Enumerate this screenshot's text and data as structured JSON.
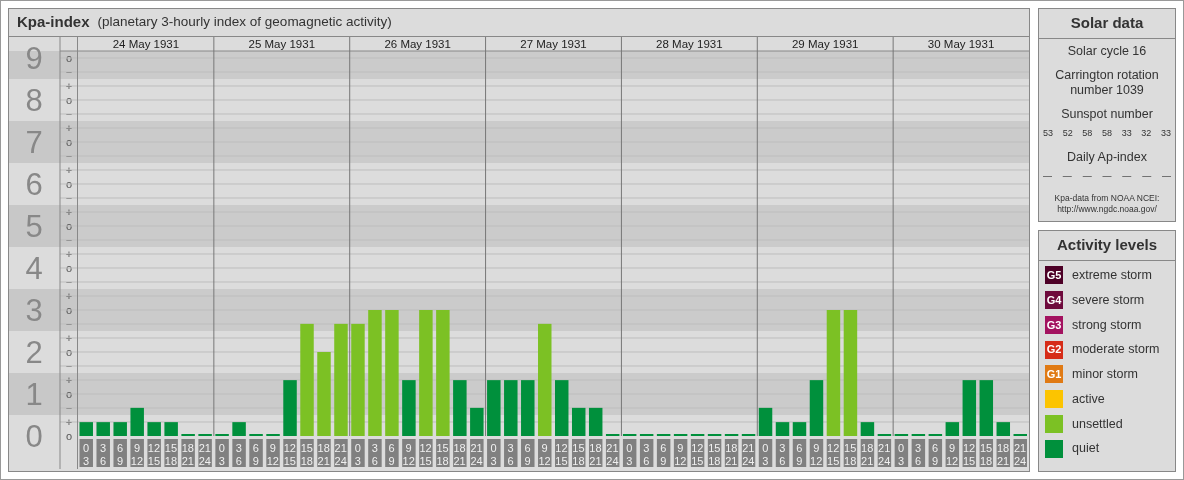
{
  "title": "Kpa-index",
  "subtitle": "(planetary 3-hourly index of geomagnetic activity)",
  "kp_scale": [
    {
      "label": "9",
      "marks": [
        "o",
        "−"
      ]
    },
    {
      "label": "8",
      "marks": [
        "+",
        "o",
        "−"
      ]
    },
    {
      "label": "7",
      "marks": [
        "+",
        "o",
        "−"
      ]
    },
    {
      "label": "6",
      "marks": [
        "+",
        "o",
        "−"
      ]
    },
    {
      "label": "5",
      "marks": [
        "+",
        "o",
        "−"
      ]
    },
    {
      "label": "4",
      "marks": [
        "+",
        "o",
        "−"
      ]
    },
    {
      "label": "3",
      "marks": [
        "+",
        "o",
        "−"
      ]
    },
    {
      "label": "2",
      "marks": [
        "+",
        "o",
        "−"
      ]
    },
    {
      "label": "1",
      "marks": [
        "+",
        "o",
        "−"
      ]
    },
    {
      "label": "0",
      "marks": [
        "+",
        "o"
      ]
    }
  ],
  "days": [
    {
      "date": "24 May 1931",
      "slots": [
        {
          "start": "0",
          "end": "3"
        },
        {
          "start": "3",
          "end": "6"
        },
        {
          "start": "6",
          "end": "9"
        },
        {
          "start": "9",
          "end": "12"
        },
        {
          "start": "12",
          "end": "15"
        },
        {
          "start": "15",
          "end": "18"
        },
        {
          "start": "18",
          "end": "21"
        },
        {
          "start": "21",
          "end": "24"
        }
      ]
    },
    {
      "date": "25 May 1931",
      "slots": [
        {
          "start": "0",
          "end": "3"
        },
        {
          "start": "3",
          "end": "6"
        },
        {
          "start": "6",
          "end": "9"
        },
        {
          "start": "9",
          "end": "12"
        },
        {
          "start": "12",
          "end": "15"
        },
        {
          "start": "15",
          "end": "18"
        },
        {
          "start": "18",
          "end": "21"
        },
        {
          "start": "21",
          "end": "24"
        }
      ]
    },
    {
      "date": "26 May 1931",
      "slots": [
        {
          "start": "0",
          "end": "3"
        },
        {
          "start": "3",
          "end": "6"
        },
        {
          "start": "6",
          "end": "9"
        },
        {
          "start": "9",
          "end": "12"
        },
        {
          "start": "12",
          "end": "15"
        },
        {
          "start": "15",
          "end": "18"
        },
        {
          "start": "18",
          "end": "21"
        },
        {
          "start": "21",
          "end": "24"
        }
      ]
    },
    {
      "date": "27 May 1931",
      "slots": [
        {
          "start": "0",
          "end": "3"
        },
        {
          "start": "3",
          "end": "6"
        },
        {
          "start": "6",
          "end": "9"
        },
        {
          "start": "9",
          "end": "12"
        },
        {
          "start": "12",
          "end": "15"
        },
        {
          "start": "15",
          "end": "18"
        },
        {
          "start": "18",
          "end": "21"
        },
        {
          "start": "21",
          "end": "24"
        }
      ]
    },
    {
      "date": "28 May 1931",
      "slots": [
        {
          "start": "0",
          "end": "3"
        },
        {
          "start": "3",
          "end": "6"
        },
        {
          "start": "6",
          "end": "9"
        },
        {
          "start": "9",
          "end": "12"
        },
        {
          "start": "12",
          "end": "15"
        },
        {
          "start": "15",
          "end": "18"
        },
        {
          "start": "18",
          "end": "21"
        },
        {
          "start": "21",
          "end": "24"
        }
      ]
    },
    {
      "date": "29 May 1931",
      "slots": [
        {
          "start": "0",
          "end": "3"
        },
        {
          "start": "3",
          "end": "6"
        },
        {
          "start": "6",
          "end": "9"
        },
        {
          "start": "9",
          "end": "12"
        },
        {
          "start": "12",
          "end": "15"
        },
        {
          "start": "15",
          "end": "18"
        },
        {
          "start": "18",
          "end": "21"
        },
        {
          "start": "21",
          "end": "24"
        }
      ]
    },
    {
      "date": "30 May 1931",
      "slots": [
        {
          "start": "0",
          "end": "3"
        },
        {
          "start": "3",
          "end": "6"
        },
        {
          "start": "6",
          "end": "9"
        },
        {
          "start": "9",
          "end": "12"
        },
        {
          "start": "12",
          "end": "15"
        },
        {
          "start": "15",
          "end": "18"
        },
        {
          "start": "18",
          "end": "21"
        },
        {
          "start": "21",
          "end": "24"
        }
      ]
    }
  ],
  "chart_data": {
    "type": "bar",
    "ylim": [
      0,
      9
    ],
    "yticks": [
      0,
      1,
      2,
      3,
      4,
      5,
      6,
      7,
      8,
      9
    ],
    "grid": true,
    "series": [
      {
        "color": "#00903c",
        "values": [
          0.33,
          0.33,
          0.33,
          0.67,
          0.33,
          0.33,
          0,
          0,
          0,
          0.33,
          0,
          0,
          1.33,
          null,
          null,
          null,
          null,
          null,
          null,
          1.33,
          null,
          null,
          1.33,
          0.67,
          1.33,
          1.33,
          1.33,
          null,
          1.33,
          0.67,
          0.67,
          0,
          0,
          0,
          0,
          0,
          0,
          0,
          0,
          0,
          0.67,
          0.33,
          0.33,
          1.33,
          null,
          null,
          0.33,
          0,
          0,
          0,
          0,
          0.33,
          1.33,
          1.33,
          0.33,
          0
        ]
      },
      {
        "color": "#7cc124",
        "values": [
          null,
          null,
          null,
          null,
          null,
          null,
          null,
          null,
          null,
          null,
          null,
          null,
          null,
          2.67,
          2,
          2.67,
          2.67,
          3,
          3,
          null,
          3,
          3,
          null,
          null,
          null,
          null,
          null,
          2.67,
          null,
          null,
          null,
          null,
          null,
          null,
          null,
          null,
          null,
          null,
          null,
          null,
          null,
          null,
          null,
          null,
          3,
          3,
          null,
          null,
          null,
          null,
          null,
          null,
          null,
          null,
          null,
          null
        ]
      }
    ]
  },
  "solar_data": {
    "title": "Solar data",
    "solar_cycle": "Solar cycle 16",
    "carrington": "Carrington rotation number 1039",
    "sunspot_title": "Sunspot number",
    "sunspot_numbers": [
      "53",
      "52",
      "58",
      "58",
      "33",
      "32",
      "33"
    ],
    "ap_title": "Daily Ap-index",
    "ap_values": [
      "—",
      "—",
      "—",
      "—",
      "—",
      "—",
      "—"
    ],
    "source": "Kpa-data from NOAA NCEI:",
    "source_url": "http://www.ngdc.noaa.gov/"
  },
  "activity_levels": {
    "title": "Activity levels",
    "items": [
      {
        "code": "G5",
        "label": "extreme storm",
        "color": "#4d0026"
      },
      {
        "code": "G4",
        "label": "severe storm",
        "color": "#6e0a3c"
      },
      {
        "code": "G3",
        "label": "strong storm",
        "color": "#a3125f"
      },
      {
        "code": "G2",
        "label": "moderate storm",
        "color": "#d62c18"
      },
      {
        "code": "G1",
        "label": "minor storm",
        "color": "#e07a14"
      },
      {
        "label": "active",
        "color": "#fcc400"
      },
      {
        "label": "unsettled",
        "color": "#7cc124"
      },
      {
        "label": "quiet",
        "color": "#00903c"
      }
    ]
  }
}
